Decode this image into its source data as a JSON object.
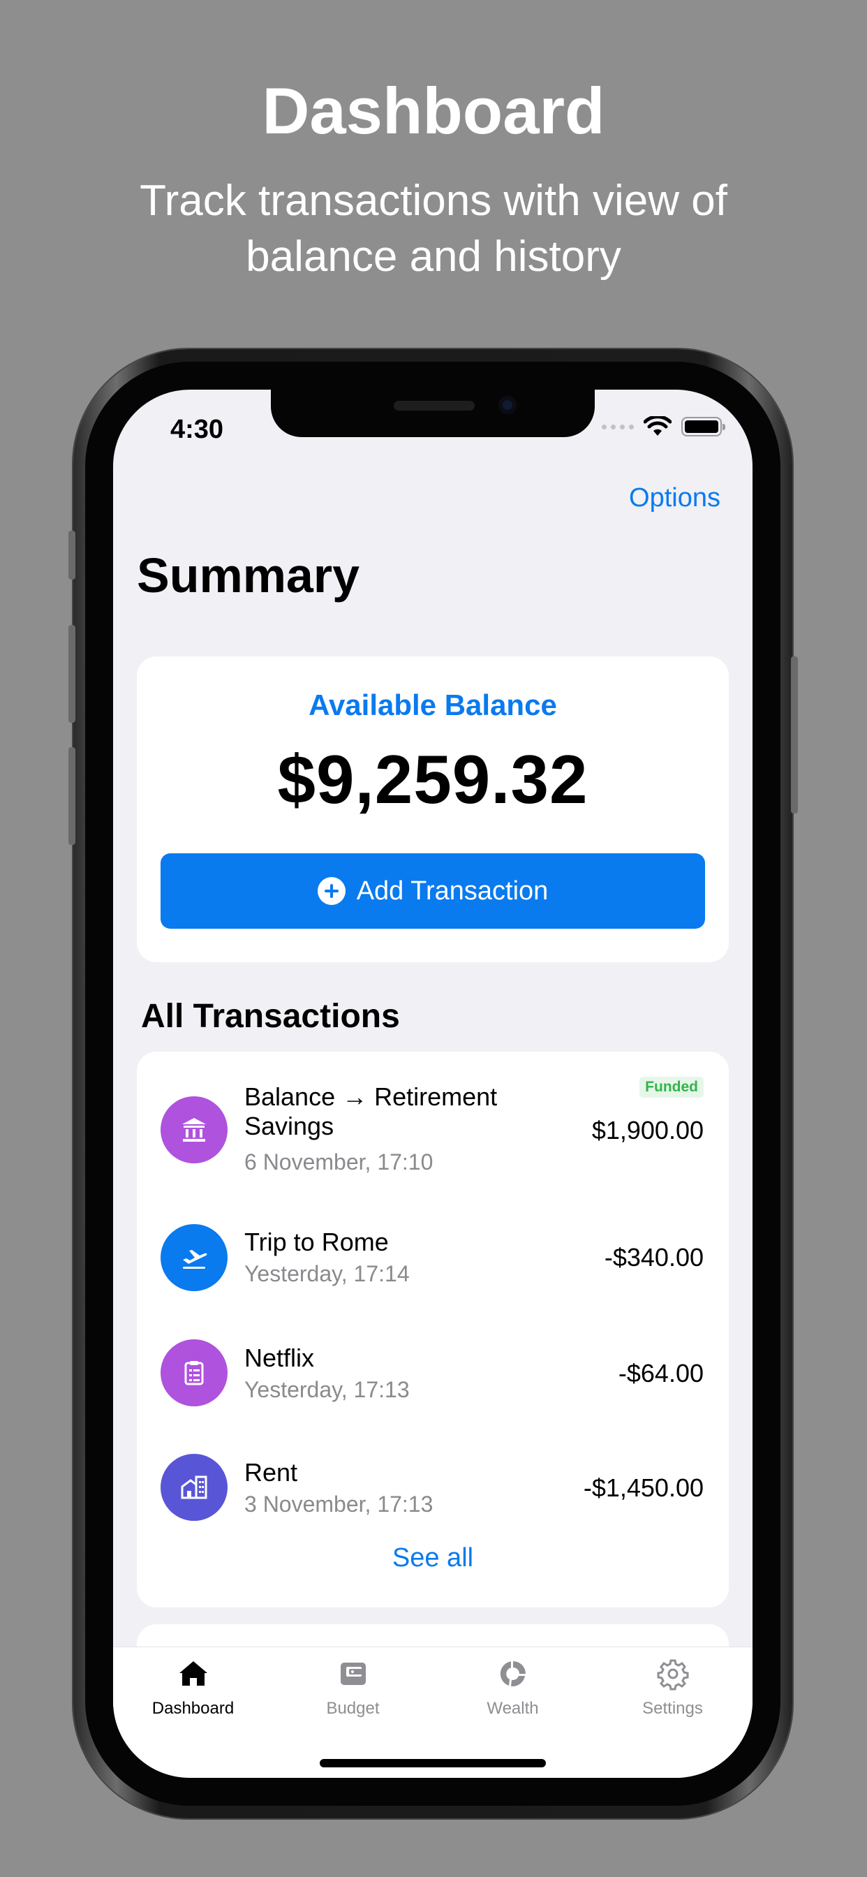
{
  "promo": {
    "title": "Dashboard",
    "subtitle": "Track transactions with view of balance and history"
  },
  "status_bar": {
    "time": "4:30"
  },
  "header": {
    "options_label": "Options",
    "title": "Summary"
  },
  "balance": {
    "label": "Available Balance",
    "amount": "$9,259.32",
    "add_button_label": "Add Transaction"
  },
  "transactions": {
    "section_title": "All Transactions",
    "items": [
      {
        "title": "Balance → Retirement Savings",
        "date": "6 November, 17:10",
        "amount": "$1,900.00",
        "badge": "Funded",
        "icon": "bank-icon",
        "icon_color": "#af52de"
      },
      {
        "title": "Trip to Rome",
        "date": "Yesterday, 17:14",
        "amount": "-$340.00",
        "icon": "airplane-icon",
        "icon_color": "#0a7aef"
      },
      {
        "title": "Netflix",
        "date": "Yesterday, 17:13",
        "amount": "-$64.00",
        "icon": "clipboard-list-icon",
        "icon_color": "#af52de"
      },
      {
        "title": "Rent",
        "date": "3 November, 17:13",
        "amount": "-$1,450.00",
        "icon": "building-icon",
        "icon_color": "#5856d6"
      }
    ],
    "see_all_label": "See all"
  },
  "tab_bar": {
    "tabs": [
      {
        "label": "Dashboard",
        "icon": "house-icon",
        "active": true
      },
      {
        "label": "Budget",
        "icon": "wallet-icon",
        "active": false
      },
      {
        "label": "Wealth",
        "icon": "pie-chart-icon",
        "active": false
      },
      {
        "label": "Settings",
        "icon": "gear-icon",
        "active": false
      }
    ]
  },
  "colors": {
    "accent": "#0a7aef",
    "background": "#8e8e8e",
    "screen_background": "#f0f0f5",
    "funded_badge_text": "#34b34c"
  }
}
